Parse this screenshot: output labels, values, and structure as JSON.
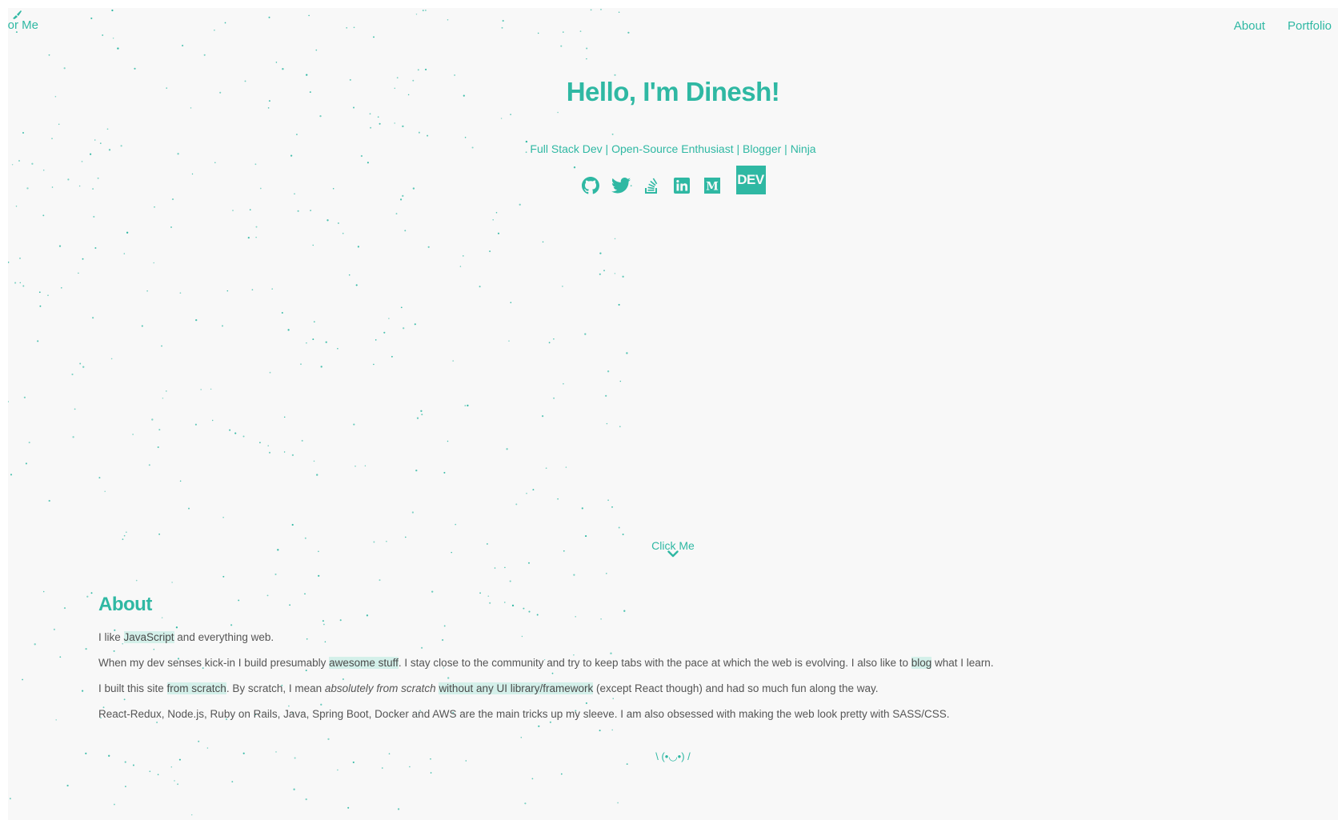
{
  "colors": {
    "accent": "#2fb8a3",
    "background": "#f8f8f8",
    "highlight": "#d4f0ea",
    "text": "#555555"
  },
  "color_me": {
    "label": "olor Me",
    "icon": "paint-brush-icon"
  },
  "nav": {
    "about": "About",
    "portfolio": "Portfolio"
  },
  "hero": {
    "title": "Hello, I'm Dinesh!",
    "tagline": "Full Stack Dev | Open-Source Enthusiast | Blogger | Ninja"
  },
  "socials": [
    {
      "name": "github-icon"
    },
    {
      "name": "twitter-icon"
    },
    {
      "name": "stackoverflow-icon"
    },
    {
      "name": "linkedin-icon"
    },
    {
      "name": "medium-icon"
    },
    {
      "name": "dev-icon",
      "label": "DEV"
    }
  ],
  "click_me": "Click Me",
  "about": {
    "heading": "About",
    "p1": {
      "t1": "I like ",
      "h1": "JavaScript",
      "t2": " and everything web."
    },
    "p2": {
      "t1": "When my dev senses kick-in I build presumably ",
      "h1": "awesome stuff",
      "t2": ". I stay close to the community and try to keep tabs with the pace at which the web is evolving. I also like to ",
      "h2": "blog",
      "t3": " what I learn."
    },
    "p3": {
      "t1": "I built this site ",
      "h1": "from scratch",
      "t2": ". By scratch, I mean ",
      "em": "absolutely from scratch",
      "t3": " ",
      "h2": "without any UI library/framework",
      "t4": " (except React though) and had so much fun along the way."
    },
    "p4": "React-Redux, Node.js, Ruby on Rails, Java, Spring Boot, Docker and AWS are the main tricks up my sleeve. I am also obsessed with making the web look pretty with SASS/CSS."
  },
  "shrug": "\\ (•◡•) /"
}
